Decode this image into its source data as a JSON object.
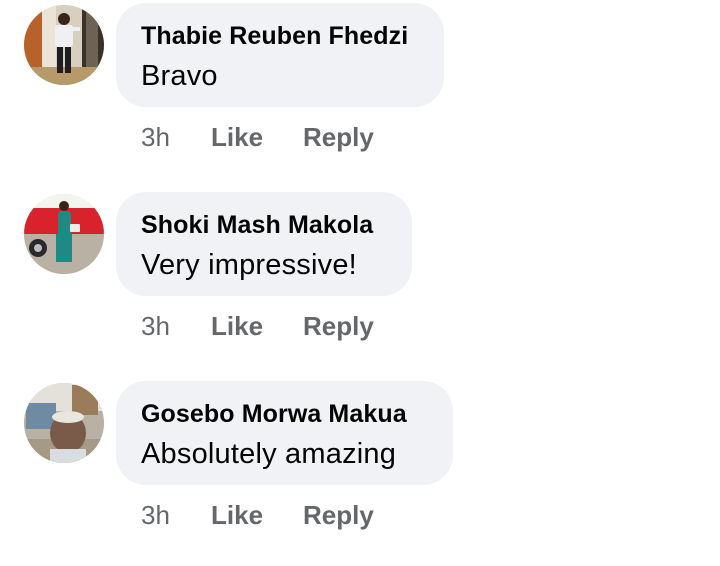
{
  "comments": [
    {
      "author": "Thabie Reuben Fhedzi",
      "text": "Bravo",
      "time": "3h",
      "like_label": "Like",
      "reply_label": "Reply"
    },
    {
      "author": "Shoki Mash Makola",
      "text": "Very impressive!",
      "time": "3h",
      "like_label": "Like",
      "reply_label": "Reply"
    },
    {
      "author": "Gosebo Morwa Makua",
      "text": "Absolutely amazing",
      "time": "3h",
      "like_label": "Like",
      "reply_label": "Reply"
    }
  ],
  "colors": {
    "bubble_background": "#f0f2f5",
    "author_text": "#050505",
    "comment_text": "#050505",
    "action_text": "#65676b"
  }
}
